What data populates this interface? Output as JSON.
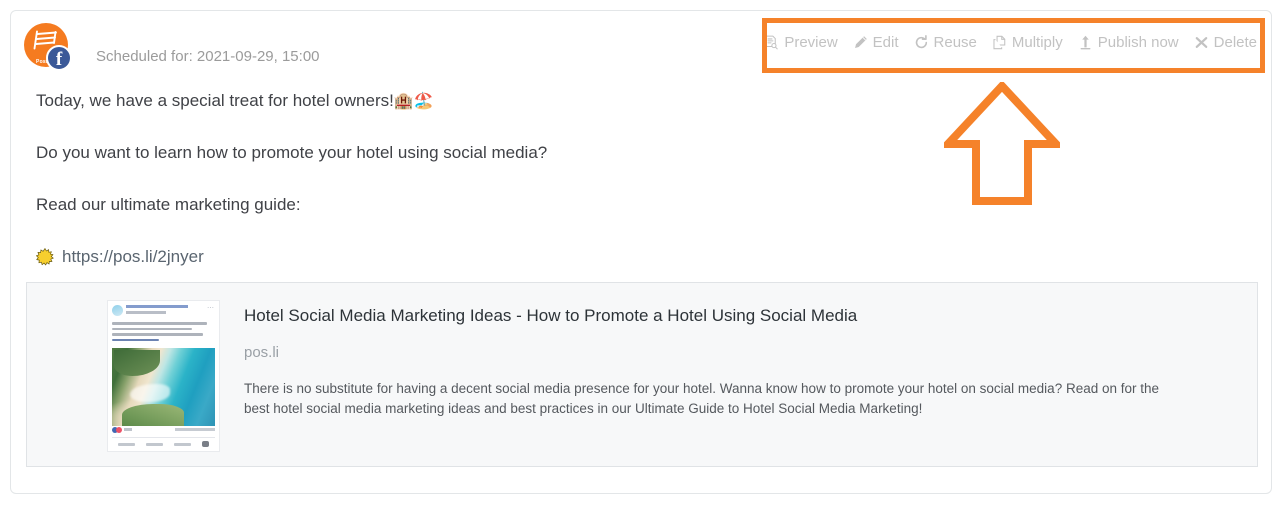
{
  "post": {
    "avatar": {
      "brand_word": "Postfity",
      "network_badge_letter": "f",
      "network": "facebook"
    },
    "scheduled_label": "Scheduled for: 2021-09-29, 15:00",
    "lines": [
      {
        "text": "Today, we have a special treat for hotel owners!",
        "emojis": "🏨🏖️"
      },
      {
        "text": "Do you want to learn how to promote your hotel using social media?",
        "emojis": ""
      },
      {
        "text": "Read our ultimate marketing guide:",
        "emojis": ""
      }
    ],
    "link_line": {
      "emoji_name": "sun-emoji",
      "url": "https://pos.li/2jnyer"
    }
  },
  "toolbar": {
    "actions": [
      {
        "label": "Preview",
        "icon": "preview-document-search-icon"
      },
      {
        "label": "Edit",
        "icon": "pencil-icon"
      },
      {
        "label": "Reuse",
        "icon": "refresh-circular-arrow-icon"
      },
      {
        "label": "Multiply",
        "icon": "duplicate-copy-icon"
      },
      {
        "label": "Publish now",
        "icon": "upload-arrow-icon"
      },
      {
        "label": "Delete",
        "icon": "close-x-icon"
      }
    ]
  },
  "link_preview": {
    "title": "Hotel Social Media Marketing Ideas - How to Promote a Hotel Using Social Media",
    "domain": "pos.li",
    "description": "There is no substitute for having a decent social media presence for your hotel. Wanna know how to promote your hotel on social media? Read on for the best hotel social media marketing ideas and best practices in our Ultimate Guide to Hotel Social Media Marketing!",
    "thumbnail_alt": "facebook-post-screenshot-beach-coastline"
  },
  "annotations": {
    "highlight_color": "#f5822a",
    "arrow_direction": "up",
    "highlight_target": "toolbar"
  },
  "colors": {
    "brand_orange": "#f57b20",
    "annotation_orange": "#f5822a",
    "facebook_blue": "#3b5998",
    "muted_text": "#9b9b9b",
    "toolbar_text": "#c2c2c2",
    "body_text": "#404247",
    "preview_bg": "#f7f8f9"
  }
}
